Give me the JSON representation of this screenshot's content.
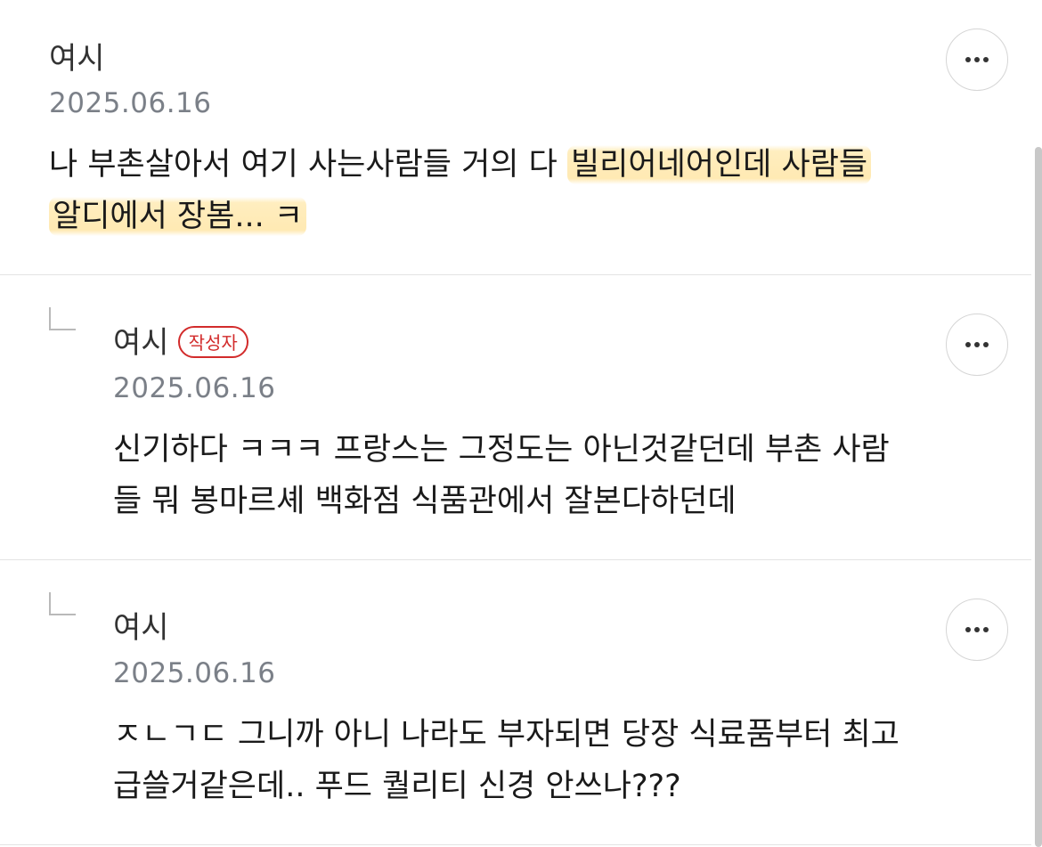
{
  "comments": [
    {
      "author": "여시",
      "date": "2025.06.16",
      "line1_pre": "나 부촌살아서 여기 사는사람들 거의 다 ",
      "line1_highlight": "빌리어네어인데 사람들",
      "line2_highlight": "알디에서 장봄... ㅋ",
      "more_icon": "more-horizontal-icon"
    },
    {
      "author": "여시",
      "badge": "작성자",
      "date": "2025.06.16",
      "line1": "신기하다 ㅋㅋㅋ 프랑스는 그정도는 아닌것같던데 부촌 사람",
      "line2": "들 뭐 봉마르셰 백화점 식품관에서 잘본다하던데",
      "reply_icon": "reply-arrow-icon",
      "more_icon": "more-horizontal-icon"
    },
    {
      "author": "여시",
      "date": "2025.06.16",
      "line1": "ㅈㄴㄱㄷ 그니까 아니 나라도 부자되면 당장 식료품부터 최고",
      "line2": "급쓸거같은데.. 푸드 퀄리티 신경 안쓰나???",
      "reply_icon": "reply-arrow-icon",
      "more_icon": "more-horizontal-icon"
    }
  ],
  "colors": {
    "badge": "#d22b2b",
    "highlight": "#ffe8aa",
    "date": "#7b8088"
  }
}
